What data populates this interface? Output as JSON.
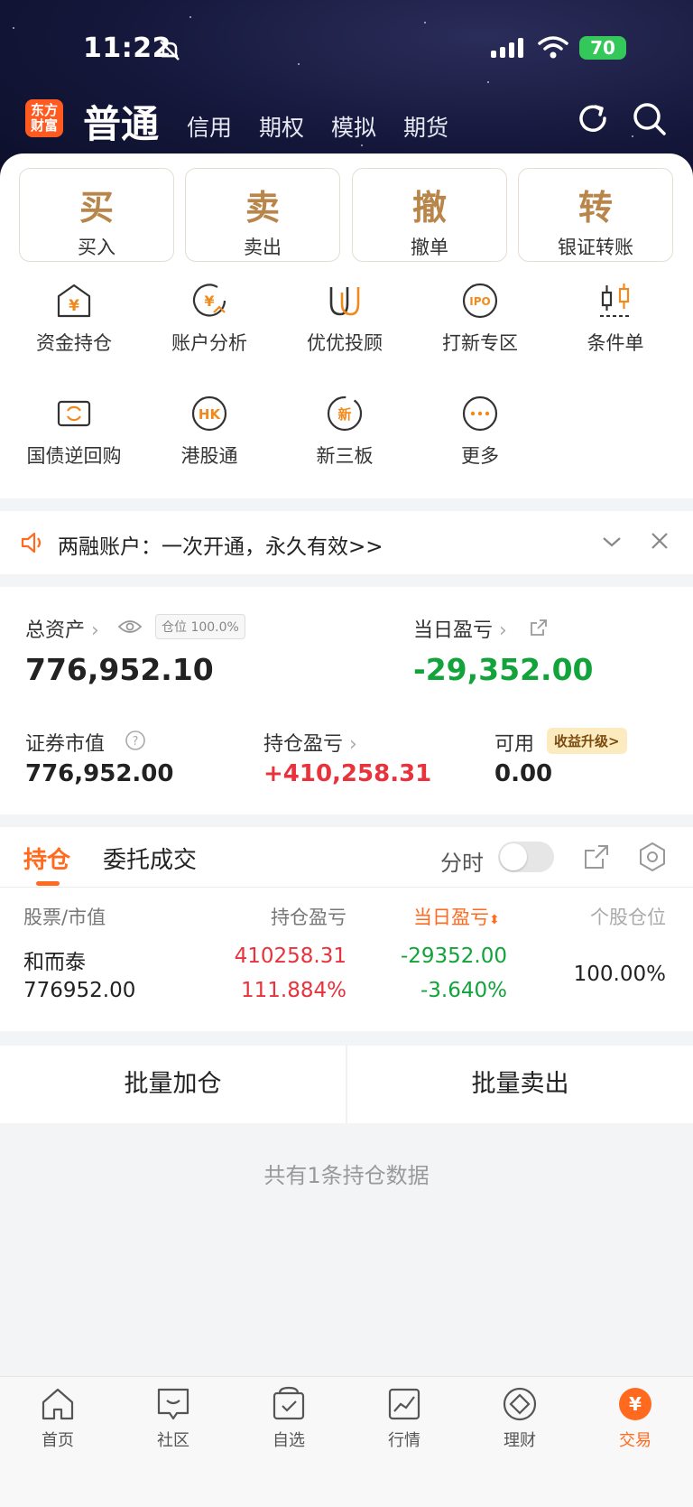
{
  "status_bar": {
    "time": "11:22",
    "battery": "70"
  },
  "nav": {
    "logo_line1": "东方",
    "logo_line2": "财富",
    "main": "普通",
    "tabs": [
      "信用",
      "期权",
      "模拟",
      "期货"
    ]
  },
  "trade_buttons": [
    {
      "big": "买",
      "small": "买入"
    },
    {
      "big": "卖",
      "small": "卖出"
    },
    {
      "big": "撤",
      "small": "撤单"
    },
    {
      "big": "转",
      "small": "银证转账"
    }
  ],
  "grid": [
    {
      "label": "资金持仓",
      "icon": "yuan-house-icon"
    },
    {
      "label": "账户分析",
      "icon": "yuan-chart-icon"
    },
    {
      "label": "优优投顾",
      "icon": "uu-icon"
    },
    {
      "label": "打新专区",
      "icon": "ipo-icon"
    },
    {
      "label": "条件单",
      "icon": "candle-icon"
    },
    {
      "label": "国债逆回购",
      "icon": "bond-icon"
    },
    {
      "label": "港股通",
      "icon": "hk-icon"
    },
    {
      "label": "新三板",
      "icon": "new-board-icon"
    },
    {
      "label": "更多",
      "icon": "more-icon"
    }
  ],
  "notice": {
    "text": "两融账户：一次开通，永久有效>>"
  },
  "assets": {
    "total_label": "总资产",
    "position_badge": "仓位 100.0%",
    "total_value": "776,952.10",
    "daily_label": "当日盈亏",
    "daily_value": "-29,352.00",
    "market_label": "证券市值",
    "market_value": "776,952.00",
    "hold_pnl_label": "持仓盈亏",
    "hold_pnl_value": "+410,258.31",
    "available_label": "可用",
    "upgrade_badge": "收益升级>",
    "available_value": "0.00"
  },
  "holdings": {
    "tab_active": "持仓",
    "tab_other": "委托成交",
    "timeshare_label": "分时",
    "headers": {
      "stock": "股票/市值",
      "hold_pnl": "持仓盈亏",
      "daily_pnl": "当日盈亏",
      "position": "个股仓位"
    },
    "rows": [
      {
        "name": "和而泰",
        "market_value": "776952.00",
        "hold_pnl": "410258.31",
        "hold_pnl_pct": "111.884%",
        "daily_pnl": "-29352.00",
        "daily_pnl_pct": "-3.640%",
        "position": "100.00%"
      }
    ]
  },
  "actions": {
    "add": "批量加仓",
    "sell": "批量卖出"
  },
  "summary": "共有1条持仓数据",
  "tabbar": [
    {
      "label": "首页",
      "icon": "home-icon"
    },
    {
      "label": "社区",
      "icon": "community-icon"
    },
    {
      "label": "自选",
      "icon": "watchlist-icon"
    },
    {
      "label": "行情",
      "icon": "market-icon"
    },
    {
      "label": "理财",
      "icon": "wealth-icon"
    },
    {
      "label": "交易",
      "icon": "trade-icon"
    }
  ],
  "colors": {
    "accent": "#ff6a1f",
    "gold": "#b8864b",
    "up": "#e8323c",
    "down": "#12a33a"
  }
}
